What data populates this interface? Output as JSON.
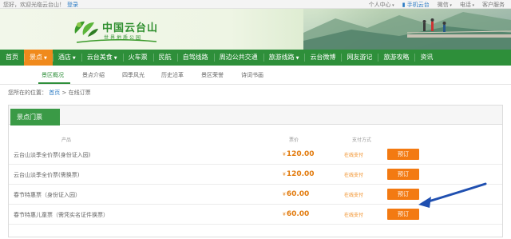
{
  "topbar": {
    "greeting": "您好，欢迎光临云台山！",
    "login": "登录",
    "links": [
      {
        "label": "个人中心",
        "dropdown": true
      },
      {
        "label": "手机云台",
        "dropdown": false
      },
      {
        "label": "微信",
        "dropdown": true
      },
      {
        "label": "电话",
        "dropdown": true
      },
      {
        "label": "客户服务",
        "dropdown": false
      }
    ]
  },
  "header": {
    "logo_text": "中国云台山",
    "logo_sub": "世界地质公园"
  },
  "nav": {
    "items": [
      {
        "label": "首页",
        "dropdown": false,
        "active": false
      },
      {
        "label": "景点",
        "dropdown": true,
        "active": true
      },
      {
        "label": "酒店",
        "dropdown": true,
        "active": false
      },
      {
        "label": "云台美食",
        "dropdown": true,
        "active": false
      },
      {
        "label": "火车票",
        "dropdown": false,
        "active": false
      },
      {
        "label": "民航",
        "dropdown": false,
        "active": false
      },
      {
        "label": "自驾线路",
        "dropdown": false,
        "active": false
      },
      {
        "label": "周边公共交通",
        "dropdown": false,
        "active": false
      },
      {
        "label": "旅游线路",
        "dropdown": true,
        "active": false
      },
      {
        "label": "云台微博",
        "dropdown": false,
        "active": false
      },
      {
        "label": "网友游记",
        "dropdown": false,
        "active": false
      },
      {
        "label": "旅游攻略",
        "dropdown": false,
        "active": false
      },
      {
        "label": "资讯",
        "dropdown": false,
        "active": false
      }
    ]
  },
  "subnav": {
    "items": [
      "景区概况",
      "景点介绍",
      "四季风光",
      "历史沿革",
      "景区荣誉",
      "诗词书画"
    ]
  },
  "breadcrumb": {
    "prefix": "您所在的位置：",
    "home": "首页",
    "sep": ">",
    "current": "在线订票"
  },
  "tickets": {
    "tab": "景点门票",
    "columns": {
      "product": "产品",
      "price": "票价",
      "payment": "支付方式"
    },
    "rows": [
      {
        "name": "云台山淡季全价票(身份证入园)",
        "currency": "¥",
        "price": "120.00",
        "payment": "在线支付",
        "button": "预订"
      },
      {
        "name": "云台山淡季全价票(需换票)",
        "currency": "¥",
        "price": "120.00",
        "payment": "在线支付",
        "button": "预订"
      },
      {
        "name": "春节特惠票（身份证入园）",
        "currency": "¥",
        "price": "60.00",
        "payment": "在线支付",
        "button": "预订"
      },
      {
        "name": "春节特惠儿童票（需凭实名证件换票）",
        "currency": "¥",
        "price": "60.00",
        "payment": "在线支付",
        "button": "预订"
      }
    ]
  },
  "colors": {
    "brand_green": "#2e8f3a",
    "accent_orange": "#f08a1c",
    "button_orange": "#f37a12",
    "price_orange": "#e27b0e",
    "annotation_blue": "#1f4fb0"
  },
  "icons": {
    "phone": "mobile-phone-icon",
    "logo": "leaf-logo-icon",
    "arrow": "annotation-arrow-icon"
  }
}
